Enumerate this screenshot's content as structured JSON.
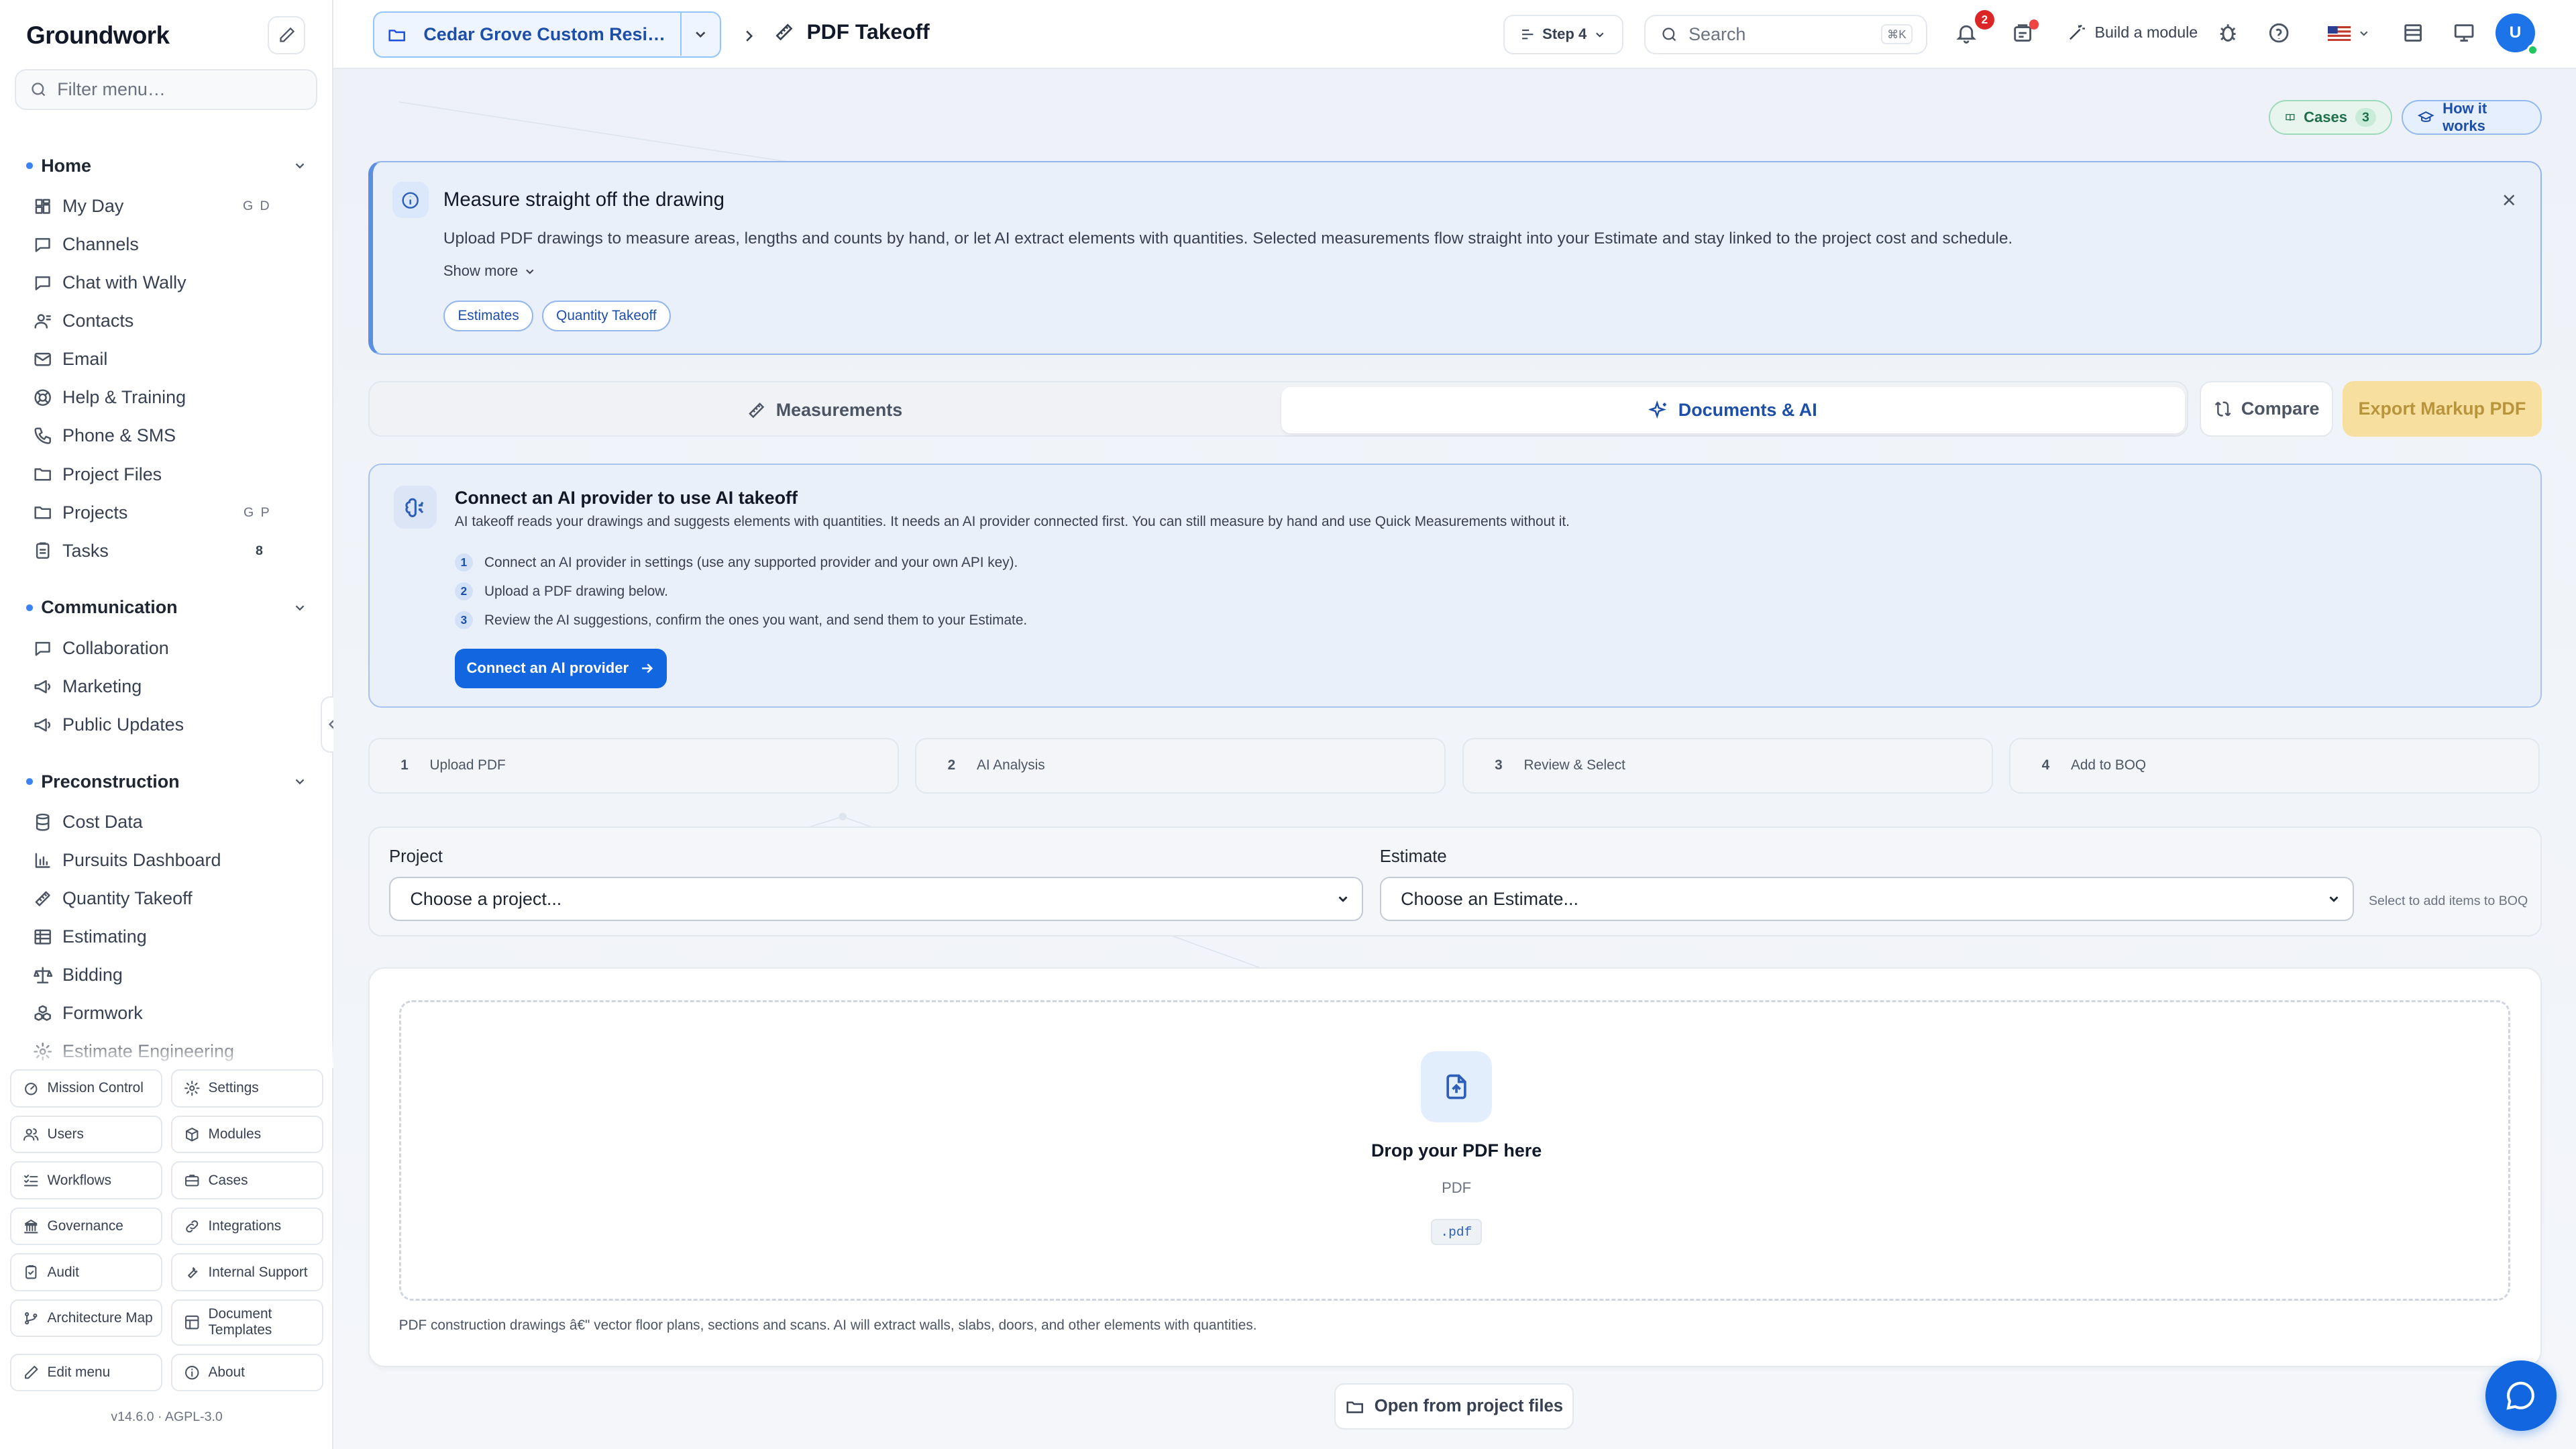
{
  "sidebar": {
    "brand": "Groundwork",
    "filter_placeholder": "Filter menu…",
    "sections": [
      {
        "title": "Home",
        "items": [
          {
            "label": "My Day",
            "icon": "dashboard-icon",
            "shortcut": "G D"
          },
          {
            "label": "Channels",
            "icon": "chat-icon"
          },
          {
            "label": "Chat with Wally",
            "icon": "chat-icon"
          },
          {
            "label": "Contacts",
            "icon": "contacts-icon"
          },
          {
            "label": "Email",
            "icon": "mail-icon"
          },
          {
            "label": "Help & Training",
            "icon": "lifebuoy-icon"
          },
          {
            "label": "Phone & SMS",
            "icon": "phone-icon"
          },
          {
            "label": "Project Files",
            "icon": "folder-icon"
          },
          {
            "label": "Projects",
            "icon": "folder-icon",
            "shortcut": "G P"
          },
          {
            "label": "Tasks",
            "icon": "clipboard-icon",
            "badge": "8"
          }
        ]
      },
      {
        "title": "Communication",
        "items": [
          {
            "label": "Collaboration",
            "icon": "chat-icon"
          },
          {
            "label": "Marketing",
            "icon": "megaphone-icon"
          },
          {
            "label": "Public Updates",
            "icon": "megaphone-icon"
          }
        ]
      },
      {
        "title": "Preconstruction",
        "items": [
          {
            "label": "Cost Data",
            "icon": "database-icon"
          },
          {
            "label": "Pursuits Dashboard",
            "icon": "bar-chart-icon"
          },
          {
            "label": "Quantity Takeoff",
            "icon": "ruler-icon"
          },
          {
            "label": "Estimating",
            "icon": "table-icon"
          },
          {
            "label": "Bidding",
            "icon": "scale-icon"
          },
          {
            "label": "Formwork",
            "icon": "boxes-icon"
          },
          {
            "label": "Estimate Engineering",
            "icon": "gear-icon"
          }
        ]
      }
    ],
    "quick_links": [
      {
        "label": "Mission Control",
        "icon": "gauge-icon"
      },
      {
        "label": "Settings",
        "icon": "gear-icon"
      },
      {
        "label": "Users",
        "icon": "users-icon"
      },
      {
        "label": "Modules",
        "icon": "package-icon"
      },
      {
        "label": "Workflows",
        "icon": "list-checks-icon"
      },
      {
        "label": "Cases",
        "icon": "briefcase-icon"
      },
      {
        "label": "Governance",
        "icon": "landmark-icon"
      },
      {
        "label": "Integrations",
        "icon": "link-icon"
      },
      {
        "label": "Audit",
        "icon": "clipboard-check-icon"
      },
      {
        "label": "Internal Support",
        "icon": "wrench-icon"
      },
      {
        "label": "Architecture Map",
        "icon": "git-branch-icon"
      },
      {
        "label": "Document Templates",
        "icon": "template-icon"
      },
      {
        "label": "Edit menu",
        "icon": "pencil-icon"
      },
      {
        "label": "About",
        "icon": "info-icon"
      }
    ],
    "version": "v14.6.0 · AGPL-3.0"
  },
  "topbar": {
    "project": "Cedar Grove Custom Reside…",
    "page_title": "PDF Takeoff",
    "step": "Step 4",
    "search_placeholder": "Search",
    "search_kbd": "⌘K",
    "notifications": "2",
    "build_label": "Build a module",
    "avatar": "U"
  },
  "main": {
    "cases_label": "Cases",
    "cases_count": "3",
    "how_label": "How it works",
    "info": {
      "title": "Measure straight off the drawing",
      "body": "Upload PDF drawings to measure areas, lengths and counts by hand, or let AI extract elements with quantities. Selected measurements flow straight into your Estimate and stay linked to the project cost and schedule.",
      "show_more": "Show more",
      "chips": [
        "Estimates",
        "Quantity Takeoff"
      ]
    },
    "tabs": {
      "measurements": "Measurements",
      "documents": "Documents & AI"
    },
    "compare": "Compare",
    "export": "Export Markup PDF",
    "ai": {
      "title": "Connect an AI provider to use AI takeoff",
      "desc": "AI takeoff reads your drawings and suggests elements with quantities. It needs an AI provider connected first. You can still measure by hand and use Quick Measurements without it.",
      "steps": [
        "Connect an AI provider in settings (use any supported provider and your own API key).",
        "Upload a PDF drawing below.",
        "Review the AI suggestions, confirm the ones you want, and send them to your Estimate."
      ],
      "button": "Connect an AI provider"
    },
    "stepper": [
      {
        "n": "1",
        "label": "Upload PDF"
      },
      {
        "n": "2",
        "label": "AI Analysis"
      },
      {
        "n": "3",
        "label": "Review & Select"
      },
      {
        "n": "4",
        "label": "Add to BOQ"
      }
    ],
    "project_label": "Project",
    "project_value": "Choose a project...",
    "estimate_label": "Estimate",
    "estimate_value": "Choose an Estimate...",
    "estimate_hint": "Select to add items to BOQ",
    "upload": {
      "title": "Drop your PDF here",
      "sub": "PDF",
      "ext": ".pdf",
      "foot": "PDF construction drawings â€\" vector floor plans, sections and scans. AI will extract walls, slabs, doors, and other elements with quantities."
    },
    "open_files": "Open from project files"
  }
}
